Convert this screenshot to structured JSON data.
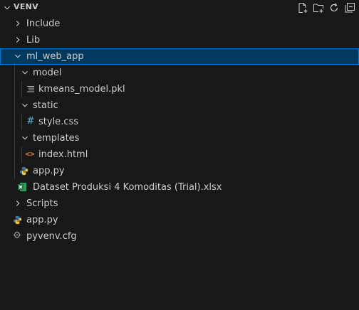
{
  "explorer": {
    "title": "VENV",
    "actions": [
      "new-file-icon",
      "new-folder-icon",
      "refresh-icon",
      "collapse-all-icon"
    ]
  },
  "tree": {
    "include": "Include",
    "lib": "Lib",
    "ml_web_app": "ml_web_app",
    "model": "model",
    "kmeans": "kmeans_model.pkl",
    "static": "static",
    "style": "style.css",
    "templates": "templates",
    "index": "index.html",
    "app_inner": "app.py",
    "dataset": "Dataset Produksi 4 Komoditas (Trial).xlsx",
    "scripts": "Scripts",
    "app_root": "app.py",
    "pyvenv": "pyvenv.cfg"
  },
  "colors": {
    "background": "#181818",
    "selection": "#04395e",
    "selection_border": "#0078d4",
    "python_blue": "#3b77a8",
    "python_yellow": "#f2c744",
    "css_blue": "#519aba",
    "html_orange": "#e37933",
    "excel_green": "#1d6f42"
  }
}
